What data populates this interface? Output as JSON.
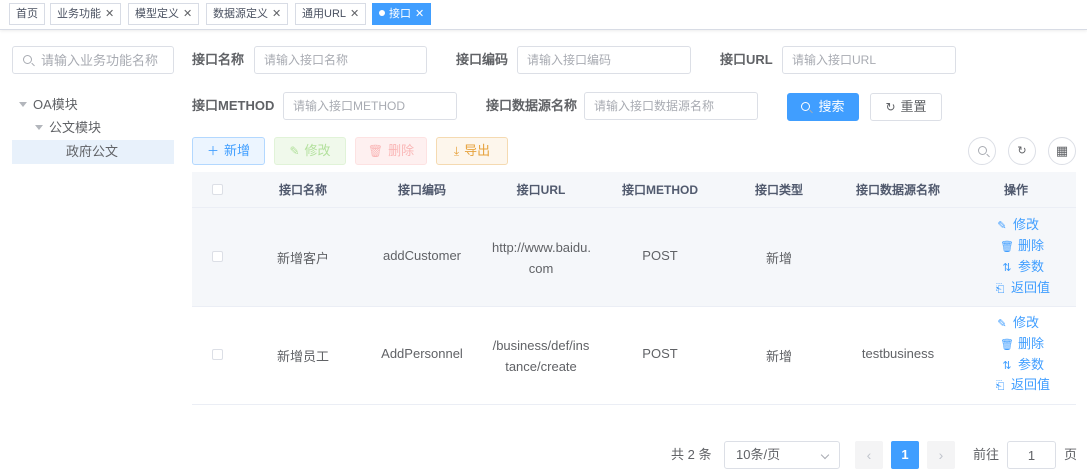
{
  "tabs": [
    {
      "label": "首页",
      "closable": false,
      "active": false
    },
    {
      "label": "业务功能",
      "closable": true,
      "active": false
    },
    {
      "label": "模型定义",
      "closable": true,
      "active": false
    },
    {
      "label": "数据源定义",
      "closable": true,
      "active": false
    },
    {
      "label": "通用URL",
      "closable": true,
      "active": false
    },
    {
      "label": "接口",
      "closable": true,
      "active": true
    }
  ],
  "sidebar": {
    "search_placeholder": "请输入业务功能名称",
    "tree": [
      {
        "label": "OA模块",
        "level": 0,
        "expanded": true
      },
      {
        "label": "公文模块",
        "level": 1,
        "expanded": true
      },
      {
        "label": "政府公文",
        "level": 2,
        "selected": true
      }
    ]
  },
  "filters": {
    "name_label": "接口名称",
    "name_placeholder": "请输入接口名称",
    "code_label": "接口编码",
    "code_placeholder": "请输入接口编码",
    "url_label": "接口URL",
    "url_placeholder": "请输入接口URL",
    "method_label": "接口METHOD",
    "method_placeholder": "请输入接口METHOD",
    "ds_label": "接口数据源名称",
    "ds_placeholder": "请输入接口数据源名称",
    "search_button": "搜索",
    "reset_button": "重置"
  },
  "toolbar": {
    "add": "新增",
    "edit": "修改",
    "delete": "删除",
    "export": "导出"
  },
  "table": {
    "columns": [
      "接口名称",
      "接口编码",
      "接口URL",
      "接口METHOD",
      "接口类型",
      "接口数据源名称",
      "操作"
    ],
    "rows": [
      {
        "name": "新增客户",
        "code": "addCustomer",
        "url_line1": "http://www.baidu.",
        "url_line2": "com",
        "method": "POST",
        "type": "新增",
        "datasource": ""
      },
      {
        "name": "新增员工",
        "code": "AddPersonnel",
        "url_line1": "/business/def/ins",
        "url_line2": "tance/create",
        "method": "POST",
        "type": "新增",
        "datasource": "testbusiness"
      }
    ],
    "actions": [
      "修改",
      "删除",
      "参数",
      "返回值"
    ]
  },
  "pagination": {
    "total_text": "共 2 条",
    "page_size": "10条/页",
    "current_page": "1",
    "goto_label": "前往",
    "goto_value": "1",
    "page_suffix": "页"
  },
  "colors": {
    "primary": "#409eff",
    "success_light": "#b3e19d",
    "danger_light": "#fab6b6",
    "warning": "#e6a23c"
  }
}
